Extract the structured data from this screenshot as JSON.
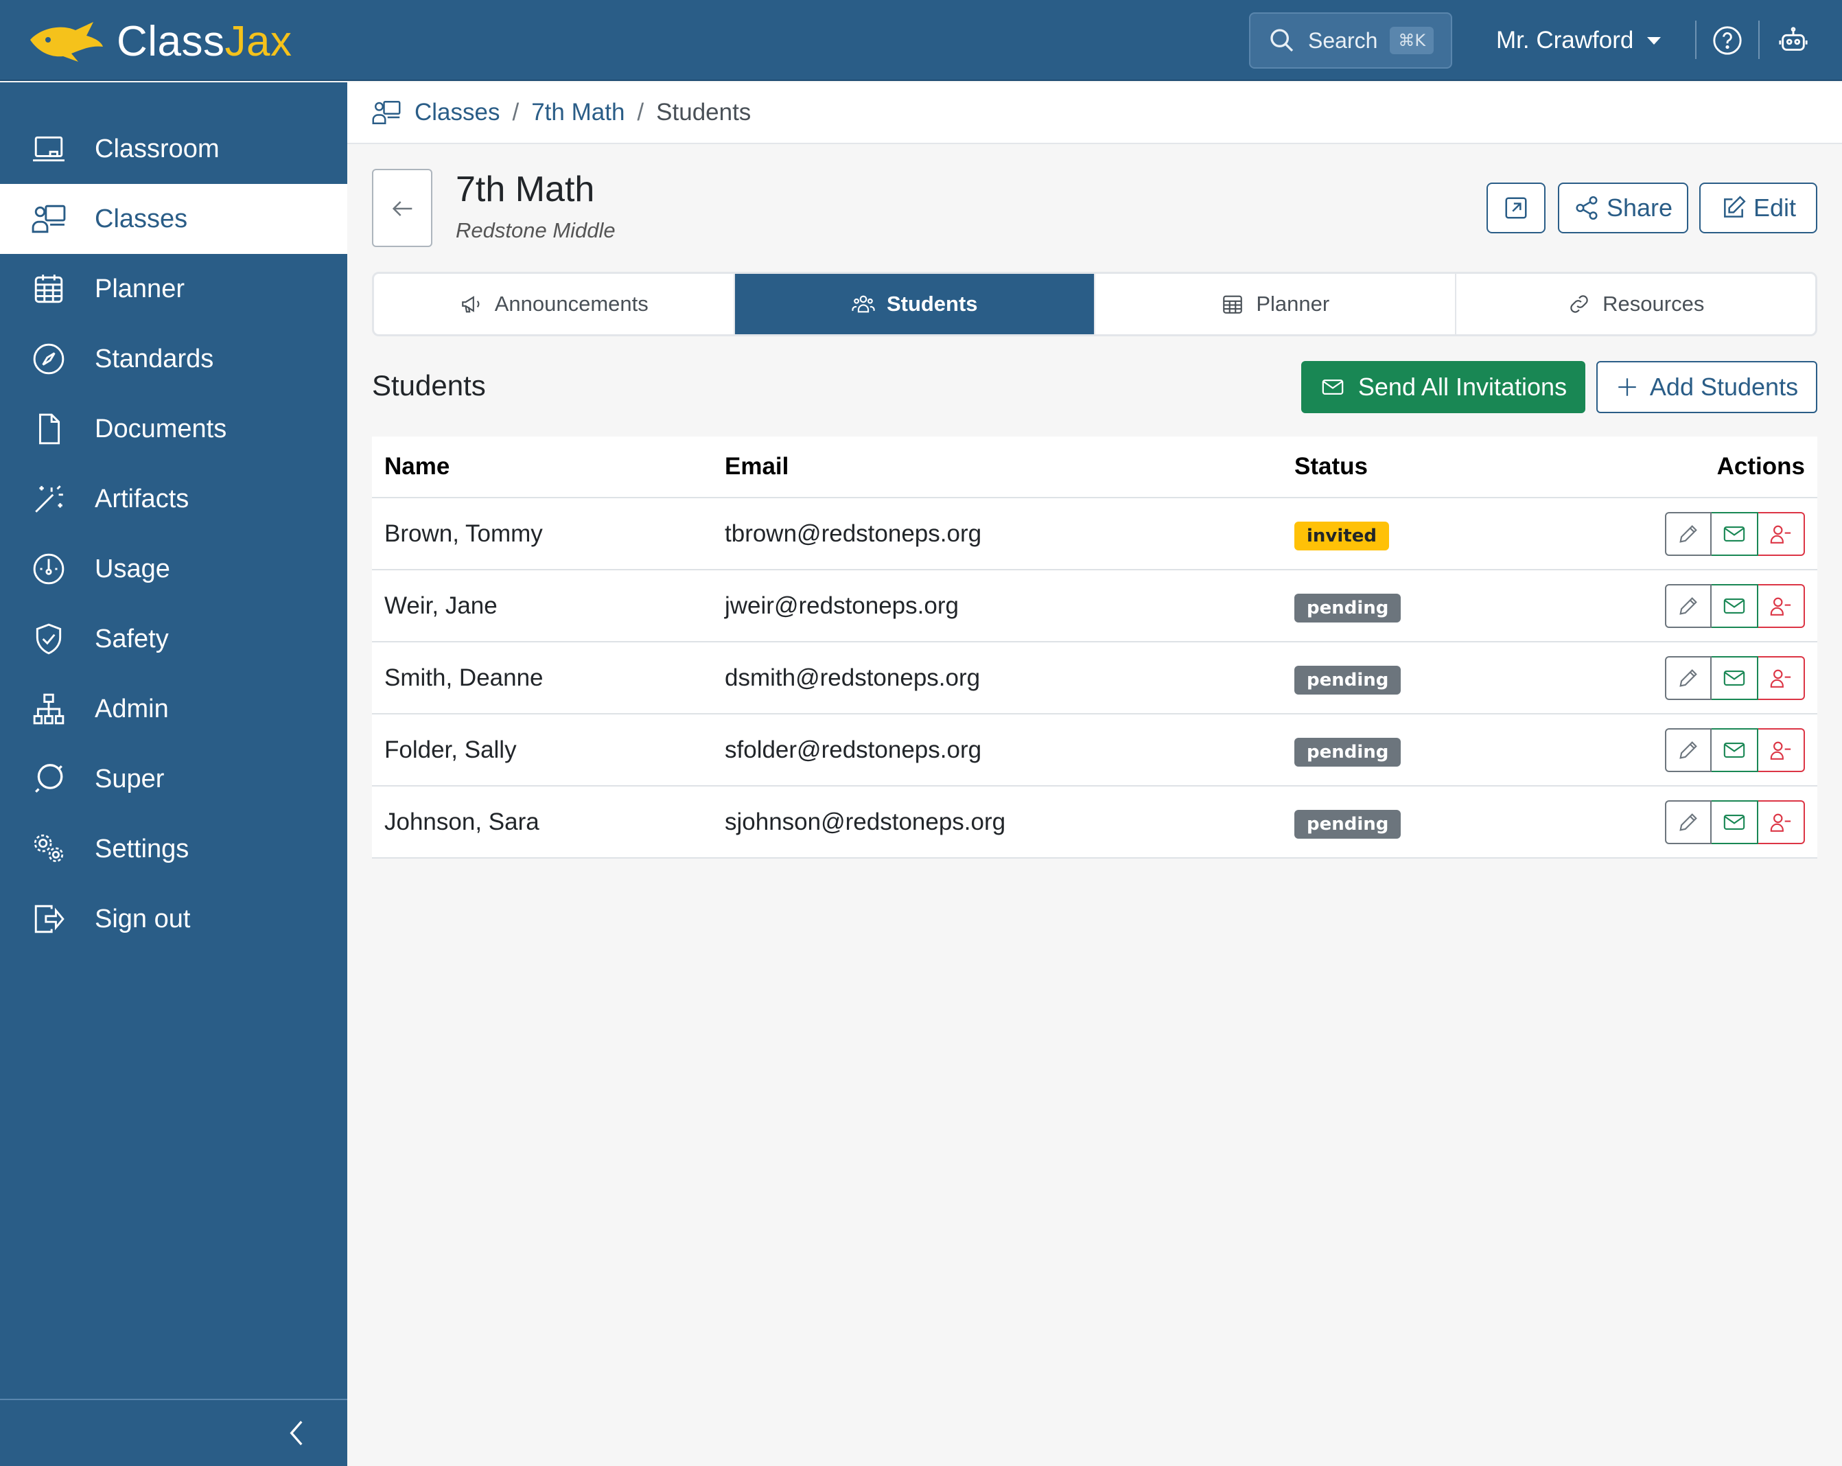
{
  "app": {
    "name_part1": "Class",
    "name_part2": "Jax",
    "accent_color": "#f5c21b",
    "primary_color": "#2a5d87"
  },
  "topbar": {
    "search_label": "Search",
    "search_shortcut": "⌘K",
    "user_name": "Mr. Crawford",
    "help_icon": "help-circle-icon",
    "assistant_icon": "robot-icon"
  },
  "sidebar": {
    "items": [
      {
        "label": "Classroom",
        "icon": "classroom-icon",
        "active": false
      },
      {
        "label": "Classes",
        "icon": "classes-icon",
        "active": true
      },
      {
        "label": "Planner",
        "icon": "calendar-icon",
        "active": false
      },
      {
        "label": "Standards",
        "icon": "compass-icon",
        "active": false
      },
      {
        "label": "Documents",
        "icon": "document-icon",
        "active": false
      },
      {
        "label": "Artifacts",
        "icon": "magic-wand-icon",
        "active": false
      },
      {
        "label": "Usage",
        "icon": "speedometer-icon",
        "active": false
      },
      {
        "label": "Safety",
        "icon": "shield-check-icon",
        "active": false
      },
      {
        "label": "Admin",
        "icon": "org-chart-icon",
        "active": false
      },
      {
        "label": "Super",
        "icon": "super-icon",
        "active": false
      },
      {
        "label": "Settings",
        "icon": "gears-icon",
        "active": false
      },
      {
        "label": "Sign out",
        "icon": "sign-out-icon",
        "active": false
      }
    ],
    "collapse_icon": "chevron-left-icon"
  },
  "breadcrumb": {
    "items": [
      "Classes",
      "7th Math"
    ],
    "separator": "/",
    "current": "Students"
  },
  "header": {
    "title": "7th Math",
    "subtitle": "Redstone Middle",
    "share_label": "Share",
    "edit_label": "Edit"
  },
  "tabs": [
    {
      "label": "Announcements",
      "icon": "megaphone-icon",
      "active": false
    },
    {
      "label": "Students",
      "icon": "people-icon",
      "active": true
    },
    {
      "label": "Planner",
      "icon": "calendar-icon",
      "active": false
    },
    {
      "label": "Resources",
      "icon": "link-icon",
      "active": false
    }
  ],
  "students": {
    "title": "Students",
    "send_all_label": "Send All Invitations",
    "add_label": "Add Students",
    "columns": [
      "Name",
      "Email",
      "Status",
      "Actions"
    ],
    "rows": [
      {
        "name": "Brown, Tommy",
        "email": "tbrown@redstoneps.org",
        "status": "invited"
      },
      {
        "name": "Weir, Jane",
        "email": "jweir@redstoneps.org",
        "status": "pending"
      },
      {
        "name": "Smith, Deanne",
        "email": "dsmith@redstoneps.org",
        "status": "pending"
      },
      {
        "name": "Folder, Sally",
        "email": "sfolder@redstoneps.org",
        "status": "pending"
      },
      {
        "name": "Johnson, Sara",
        "email": "sjohnson@redstoneps.org",
        "status": "pending"
      }
    ],
    "status_colors": {
      "invited": "#ffc107",
      "pending": "#6c757d"
    }
  }
}
